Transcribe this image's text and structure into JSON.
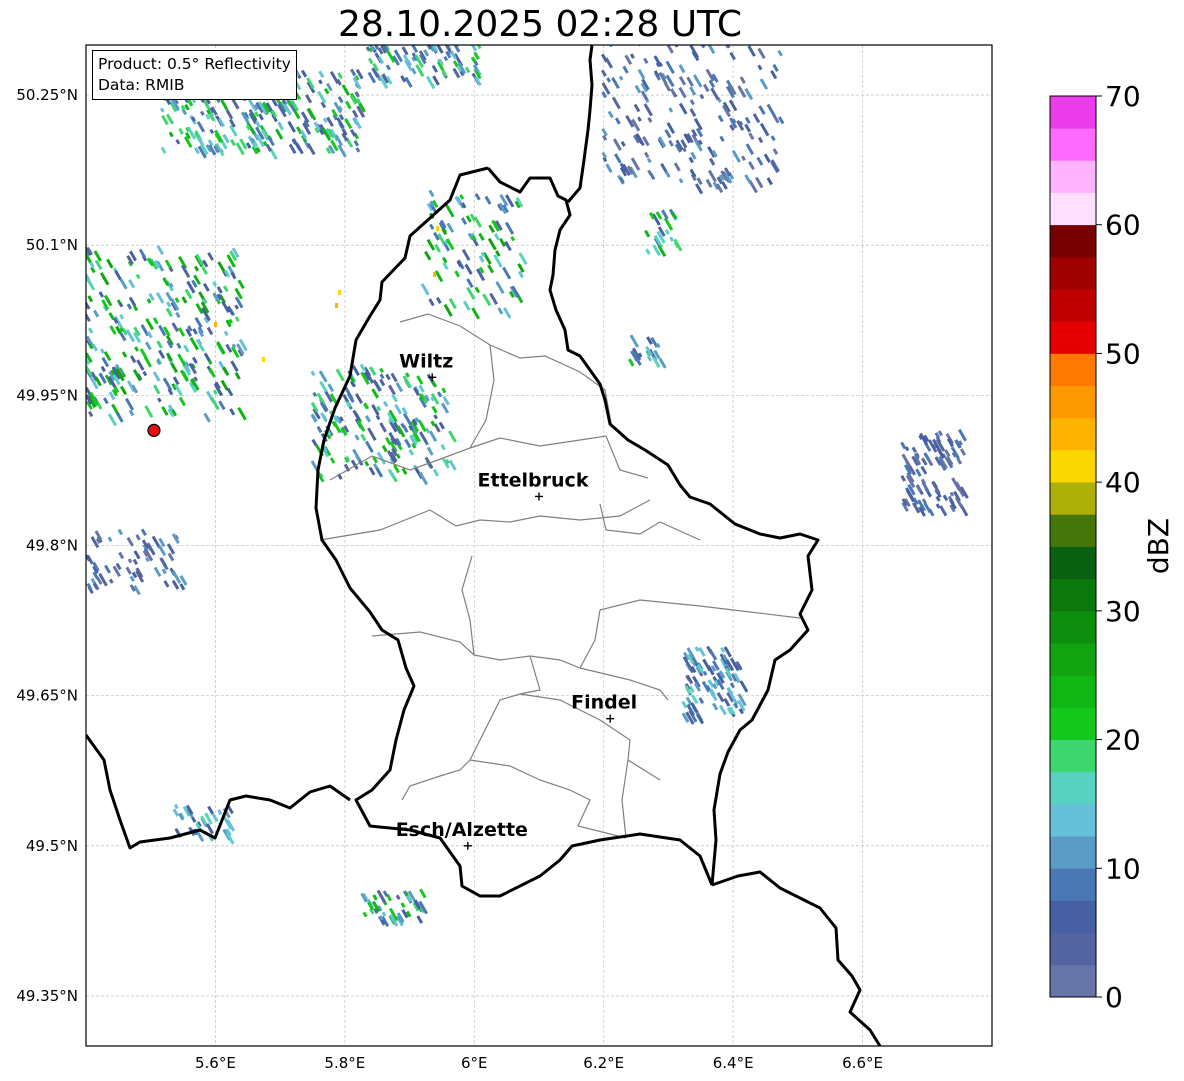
{
  "title": "28.10.2025 02:28 UTC",
  "info": {
    "product": "Product: 0.5° Reflectivity",
    "data": "Data: RMIB"
  },
  "axes": {
    "lat_ticks": [
      {
        "value": 50.25,
        "label": "50.25°N"
      },
      {
        "value": 50.1,
        "label": "50.1°N"
      },
      {
        "value": 49.95,
        "label": "49.95°N"
      },
      {
        "value": 49.8,
        "label": "49.8°N"
      },
      {
        "value": 49.65,
        "label": "49.65°N"
      },
      {
        "value": 49.5,
        "label": "49.5°N"
      },
      {
        "value": 49.35,
        "label": "49.35°N"
      }
    ],
    "lon_ticks": [
      {
        "value": 5.6,
        "label": "5.6°E"
      },
      {
        "value": 5.8,
        "label": "5.8°E"
      },
      {
        "value": 6.0,
        "label": "6°E"
      },
      {
        "value": 6.2,
        "label": "6.2°E"
      },
      {
        "value": 6.4,
        "label": "6.4°E"
      },
      {
        "value": 6.6,
        "label": "6.6°E"
      }
    ],
    "lon_range": [
      5.4,
      6.8
    ],
    "lat_range": [
      49.3,
      50.3
    ],
    "grid": true
  },
  "cities": [
    {
      "name": "Wiltz",
      "lon": 5.935,
      "lat": 49.968
    },
    {
      "name": "Ettelbruck",
      "lon": 6.1,
      "lat": 49.849
    },
    {
      "name": "Findel",
      "lon": 6.21,
      "lat": 49.627
    },
    {
      "name": "Esch/Alzette",
      "lon": 5.99,
      "lat": 49.5
    }
  ],
  "radar_site": {
    "lon": 5.505,
    "lat": 49.915,
    "color": "#e01010"
  },
  "colorbar": {
    "label": "dBZ",
    "min": 0,
    "max": 70,
    "ticks": [
      "0",
      "10",
      "20",
      "30",
      "40",
      "50",
      "60",
      "70"
    ],
    "colors": [
      "#6674a8",
      "#5364a0",
      "#4660a2",
      "#4a78b4",
      "#5a9cc6",
      "#66c0da",
      "#5ad2c2",
      "#3ed66e",
      "#14c81c",
      "#10b614",
      "#12a410",
      "#0e8e0e",
      "#0a780c",
      "#086010",
      "#44760a",
      "#acb008",
      "#fcd600",
      "#fcb400",
      "#fc9800",
      "#fc7a00",
      "#e40000",
      "#c00000",
      "#a00000",
      "#780000",
      "#fee0fe",
      "#feb4fe",
      "#fe6afe",
      "#ea3cea"
    ]
  }
}
